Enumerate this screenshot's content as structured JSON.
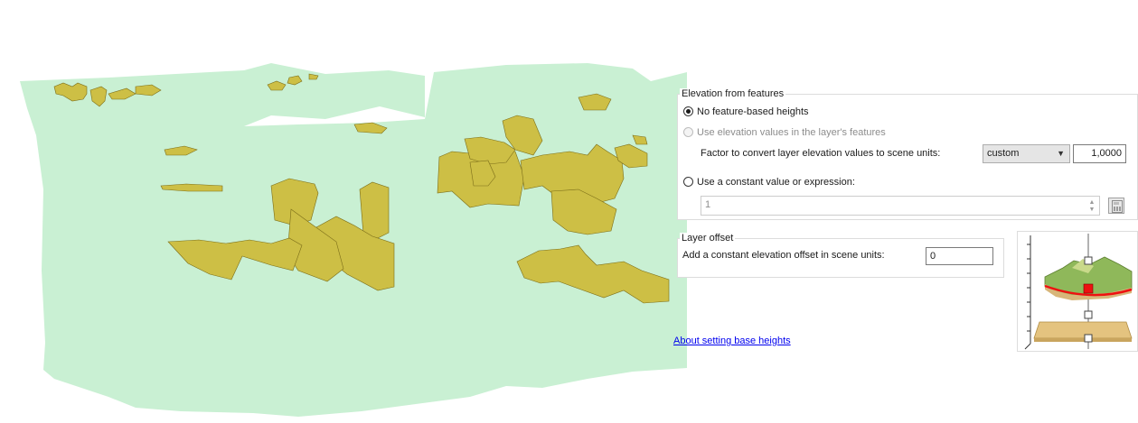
{
  "elevation_group": {
    "title": "Elevation from features",
    "option_no_heights": "No feature-based heights",
    "option_use_values": "Use elevation values in the layer's features",
    "factor_label": "Factor to convert layer elevation values to scene units:",
    "factor_unit_selected": "custom",
    "factor_value": "1,0000",
    "option_constant": "Use a constant value or expression:",
    "constant_value": "1"
  },
  "offset_group": {
    "title": "Layer offset",
    "label": "Add a constant elevation offset in scene units:",
    "value": "0"
  },
  "help_link": "About setting base heights",
  "icons": {
    "chevron": "chevron-down-icon",
    "spin_up": "spin-up-icon",
    "spin_down": "spin-down-icon",
    "calculator": "expression-builder-icon",
    "illustration": "base-heights-diagram-icon"
  },
  "colors": {
    "scene_ground": "#c9f0d3",
    "extrusion": "#cdbf45",
    "offset_marker": "#ee1111"
  }
}
